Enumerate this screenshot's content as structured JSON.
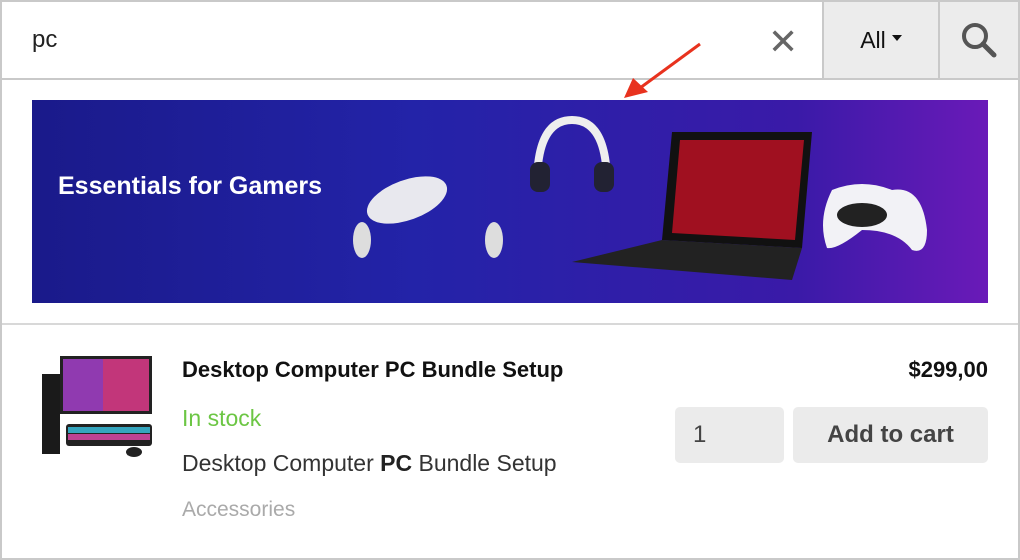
{
  "search": {
    "query": "pc",
    "category": "All",
    "clear_icon": "close-icon",
    "search_icon": "search-icon"
  },
  "banner": {
    "title": "Essentials for Gamers"
  },
  "product": {
    "title": "Desktop Computer PC Bundle Setup",
    "stock": "In stock",
    "desc_before": "Desktop Computer ",
    "desc_highlight": "PC",
    "desc_after": " Bundle Setup",
    "category": "Accessories",
    "price": "$299,00",
    "quantity": "1",
    "add_label": "Add to cart"
  },
  "colors": {
    "stock": "#6cc644",
    "annotation_arrow": "#e8321e"
  }
}
